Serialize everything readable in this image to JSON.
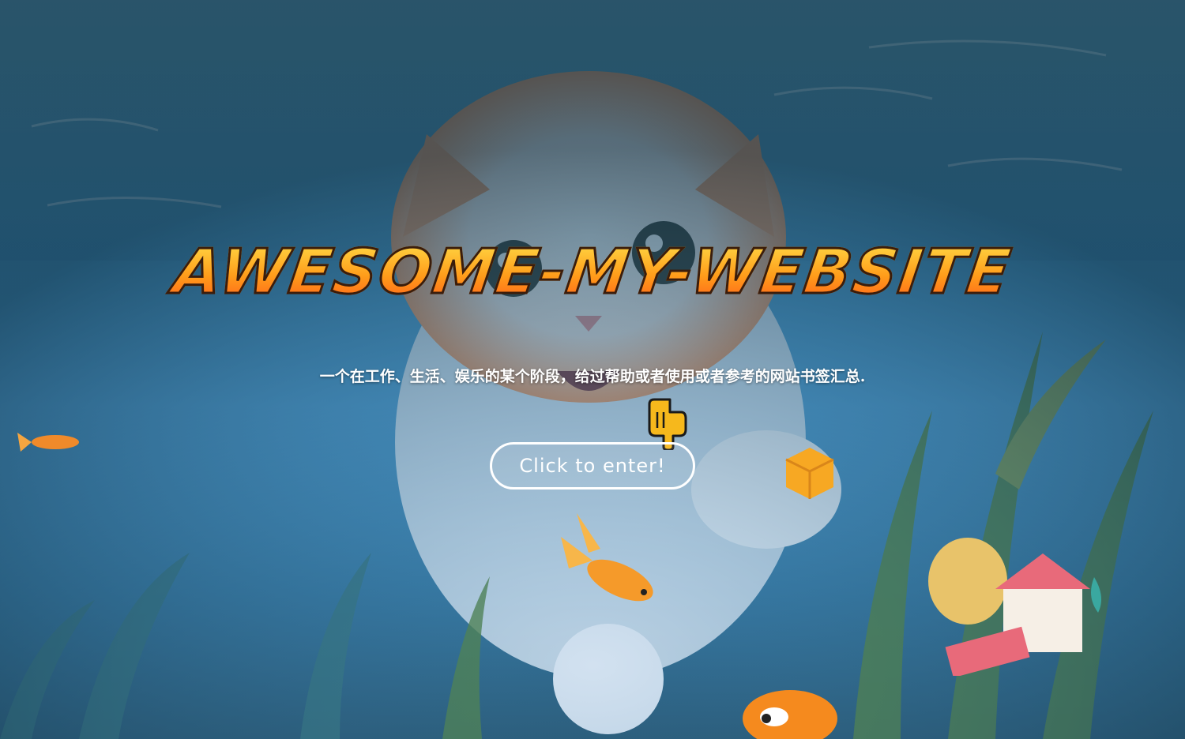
{
  "hero": {
    "title": "AWESOME-MY-WEBSITE",
    "subtitle": "一个在工作、生活、娱乐的某个阶段，给过帮助或者使用或者参考的网站书签汇总.",
    "enter_label": "Click to enter!"
  },
  "background": {
    "scene": "underwater-cat-illustration",
    "icons": [
      "pointing-hand-icon",
      "cheese-cube-icon",
      "goldfish-icon",
      "toy-house-icon"
    ]
  },
  "colors": {
    "title_top": "#ffe14a",
    "title_bottom": "#ff5a1a",
    "button_border": "#ffffff",
    "water": "#3e8fbf"
  }
}
